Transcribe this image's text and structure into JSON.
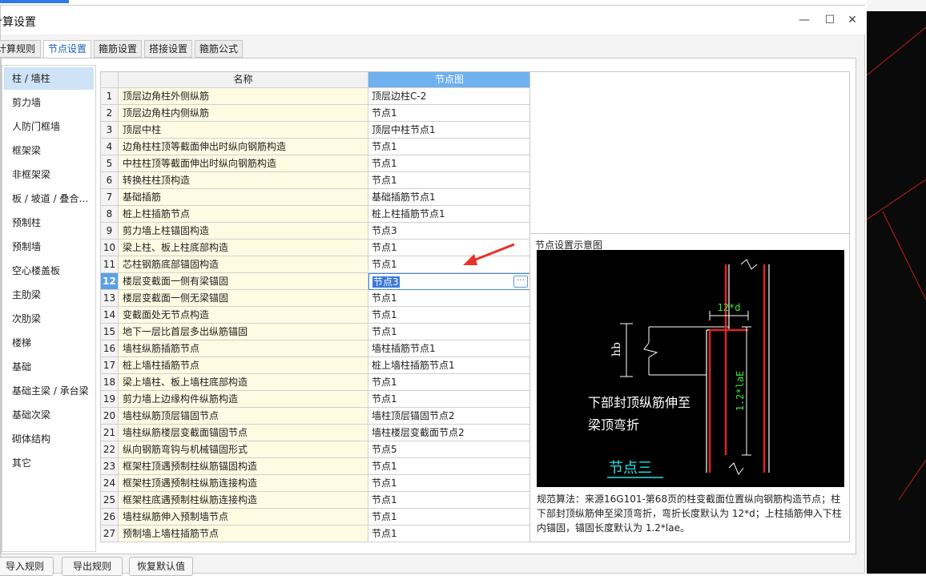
{
  "dialog": {
    "title": "计算设置",
    "window_controls": [
      "minimize",
      "maximize",
      "close"
    ]
  },
  "tabs": [
    {
      "label": "计算规则",
      "active": false
    },
    {
      "label": "节点设置",
      "active": true
    },
    {
      "label": "箍筋设置",
      "active": false
    },
    {
      "label": "搭接设置",
      "active": false
    },
    {
      "label": "箍筋公式",
      "active": false
    }
  ],
  "sidebar": {
    "items": [
      {
        "label": "柱 / 墙柱",
        "active": true
      },
      {
        "label": "剪力墙"
      },
      {
        "label": "人防门框墙"
      },
      {
        "label": "框架梁"
      },
      {
        "label": "非框架梁"
      },
      {
        "label": "板 / 坡道 / 叠合…"
      },
      {
        "label": "预制柱"
      },
      {
        "label": "预制墙"
      },
      {
        "label": "空心楼盖板"
      },
      {
        "label": "主肋梁"
      },
      {
        "label": "次肋梁"
      },
      {
        "label": "楼梯"
      },
      {
        "label": "基础"
      },
      {
        "label": "基础主梁 / 承台梁"
      },
      {
        "label": "基础次梁"
      },
      {
        "label": "砌体结构"
      },
      {
        "label": "其它"
      }
    ]
  },
  "grid": {
    "columns": [
      "名称",
      "节点图"
    ],
    "selected_row": 12,
    "rows": [
      {
        "num": "1",
        "name": "顶层边角柱外侧纵筋",
        "value": "顶层边柱C-2"
      },
      {
        "num": "2",
        "name": "顶层边角柱内侧纵筋",
        "value": "节点1"
      },
      {
        "num": "3",
        "name": "顶层中柱",
        "value": "顶层中柱节点1"
      },
      {
        "num": "4",
        "name": "边角柱柱顶等截面伸出时纵向钢筋构造",
        "value": "节点1"
      },
      {
        "num": "5",
        "name": "中柱柱顶等截面伸出时纵向钢筋构造",
        "value": "节点1"
      },
      {
        "num": "6",
        "name": "转换柱柱顶构造",
        "value": "节点1"
      },
      {
        "num": "7",
        "name": "基础插筋",
        "value": "基础插筋节点1"
      },
      {
        "num": "8",
        "name": "桩上柱插筋节点",
        "value": "桩上柱插筋节点1"
      },
      {
        "num": "9",
        "name": "剪力墙上柱锚固构造",
        "value": "节点3"
      },
      {
        "num": "10",
        "name": "梁上柱、板上柱底部构造",
        "value": "节点1"
      },
      {
        "num": "11",
        "name": "芯柱钢筋底部锚固构造",
        "value": "节点1"
      },
      {
        "num": "12",
        "name": "楼层变截面一侧有梁锚固",
        "value": "节点3"
      },
      {
        "num": "13",
        "name": "楼层变截面一侧无梁锚固",
        "value": "节点1"
      },
      {
        "num": "14",
        "name": "变截面处无节点构造",
        "value": "节点1"
      },
      {
        "num": "15",
        "name": "地下一层比首层多出纵筋锚固",
        "value": "节点1"
      },
      {
        "num": "16",
        "name": "墙柱纵筋插筋节点",
        "value": "墙柱插筋节点1"
      },
      {
        "num": "17",
        "name": "桩上墙柱插筋节点",
        "value": "桩上墙柱插筋节点1"
      },
      {
        "num": "18",
        "name": "梁上墙柱、板上墙柱底部构造",
        "value": "节点1"
      },
      {
        "num": "19",
        "name": "剪力墙上边缘构件纵筋构造",
        "value": "节点1"
      },
      {
        "num": "20",
        "name": "墙柱纵筋顶层锚固节点",
        "value": "墙柱顶层锚固节点2"
      },
      {
        "num": "21",
        "name": "墙柱纵筋楼层变截面锚固节点",
        "value": "墙柱楼层变截面节点2"
      },
      {
        "num": "22",
        "name": "纵向钢筋弯钩与机械锚固形式",
        "value": "节点5"
      },
      {
        "num": "23",
        "name": "框架柱顶遇预制柱纵筋锚固构造",
        "value": "节点1"
      },
      {
        "num": "24",
        "name": "框架柱顶遇预制柱纵筋连接构造",
        "value": "节点1"
      },
      {
        "num": "25",
        "name": "框架柱底遇预制柱纵筋连接构造",
        "value": "节点1"
      },
      {
        "num": "26",
        "name": "墙柱纵筋伸入预制墙节点",
        "value": "节点1"
      },
      {
        "num": "27",
        "name": "预制墙上墙柱插筋节点",
        "value": "节点1"
      }
    ]
  },
  "preview": {
    "title": "节点设置示意图",
    "diagram": {
      "dim_top": "12*d",
      "dim_left": "hb",
      "dim_right": "1.2*laE",
      "caption_line1": "下部封顶纵筋伸至",
      "caption_line2": "梁顶弯折",
      "node_label": "节点三"
    },
    "description": "规范算法：来源16G101-第68页的柱变截面位置纵向钢筋构造节点；柱下部封顶纵筋伸至梁顶弯折，弯折长度默认为 12*d；上柱插筋伸入下柱内锚固，锚固长度默认为 1.2*lae。"
  },
  "footer": {
    "buttons": [
      "导入规则",
      "导出规则",
      "恢复默认值"
    ]
  },
  "colors": {
    "accent": "#3c8ae0",
    "selected_header": "#6fb0ef",
    "name_cell_bg": "#fffbe3",
    "annotation_arrow": "#e8322a"
  }
}
